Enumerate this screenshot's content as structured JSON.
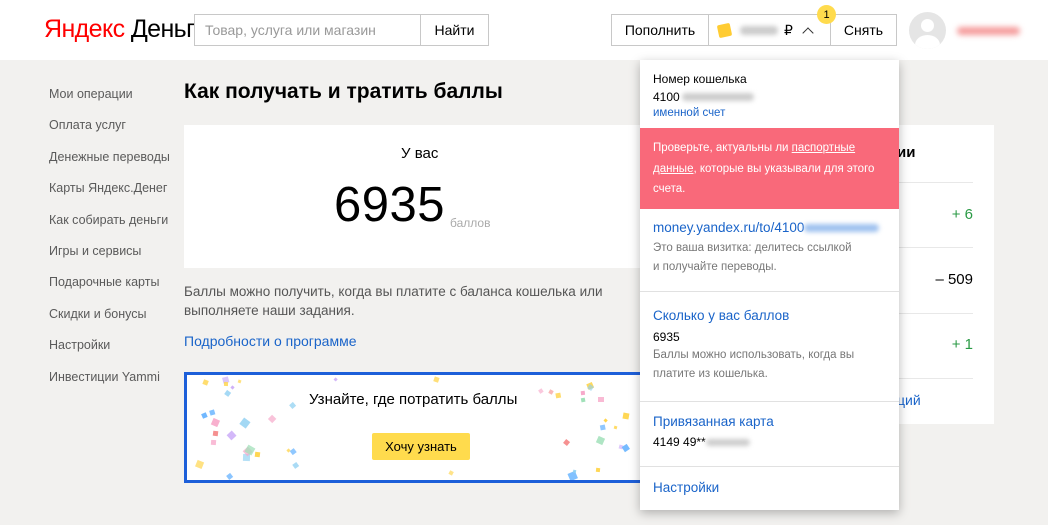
{
  "header": {
    "logo_brand": "Яндекс",
    "logo_product": "Деньги",
    "search_placeholder": "Товар, услуга или магазин",
    "search_button": "Найти",
    "topup_button": "Пополнить",
    "currency": "₽",
    "notification_count": "1",
    "withdraw_button": "Снять"
  },
  "sidebar": {
    "items": [
      {
        "label": "Мои операции"
      },
      {
        "label": "Оплата услуг"
      },
      {
        "label": "Денежные переводы"
      },
      {
        "label": "Карты Яндекс.Денег"
      },
      {
        "label": "Как собирать деньги"
      },
      {
        "label": "Игры и сервисы"
      },
      {
        "label": "Подарочные карты"
      },
      {
        "label": "Скидки и бонусы"
      },
      {
        "label": "Настройки"
      },
      {
        "label": "Инвестиции Yammi"
      }
    ]
  },
  "main": {
    "title": "Как получать и тратить баллы",
    "card_heading": "У вас",
    "points": "6935",
    "points_unit": "баллов",
    "info_text": "Баллы можно получить, когда вы платите с баланса кошелька или выполняете наши задания.",
    "details_link": "Подробности о программе",
    "promo_title": "Узнайте, где потратить баллы",
    "promo_button": "Хочу узнать"
  },
  "side_card": {
    "heading": "ии",
    "amounts": [
      "+ 6",
      "– 509",
      "+ 1"
    ],
    "link": "ций"
  },
  "dropdown": {
    "wallet_label": "Номер кошелька",
    "wallet_prefix": "4100",
    "named_account": "именной счет",
    "alert_before": "Проверьте, актуальны ли ",
    "alert_link": "паспортные данные",
    "alert_after": ", которые вы указывали для этого счета.",
    "card_url": "money.yandex.ru/to/4100",
    "card_url_desc": "Это ваша визитка: делитесь ссылкой и получайте переводы.",
    "points_link": "Сколько у вас баллов",
    "points_value": "6935",
    "points_desc": "Баллы можно использовать, когда вы платите из кошелька.",
    "linked_card_link": "Привязанная карта",
    "linked_card_prefix": "4149 49**",
    "settings_link": "Настройки"
  },
  "colors": {
    "accent_link": "#1a64c9",
    "alert_bg": "#f9697a",
    "promo_border": "#1d5fd9",
    "button_yellow": "#ffdb4d",
    "positive": "#2a9a45"
  }
}
